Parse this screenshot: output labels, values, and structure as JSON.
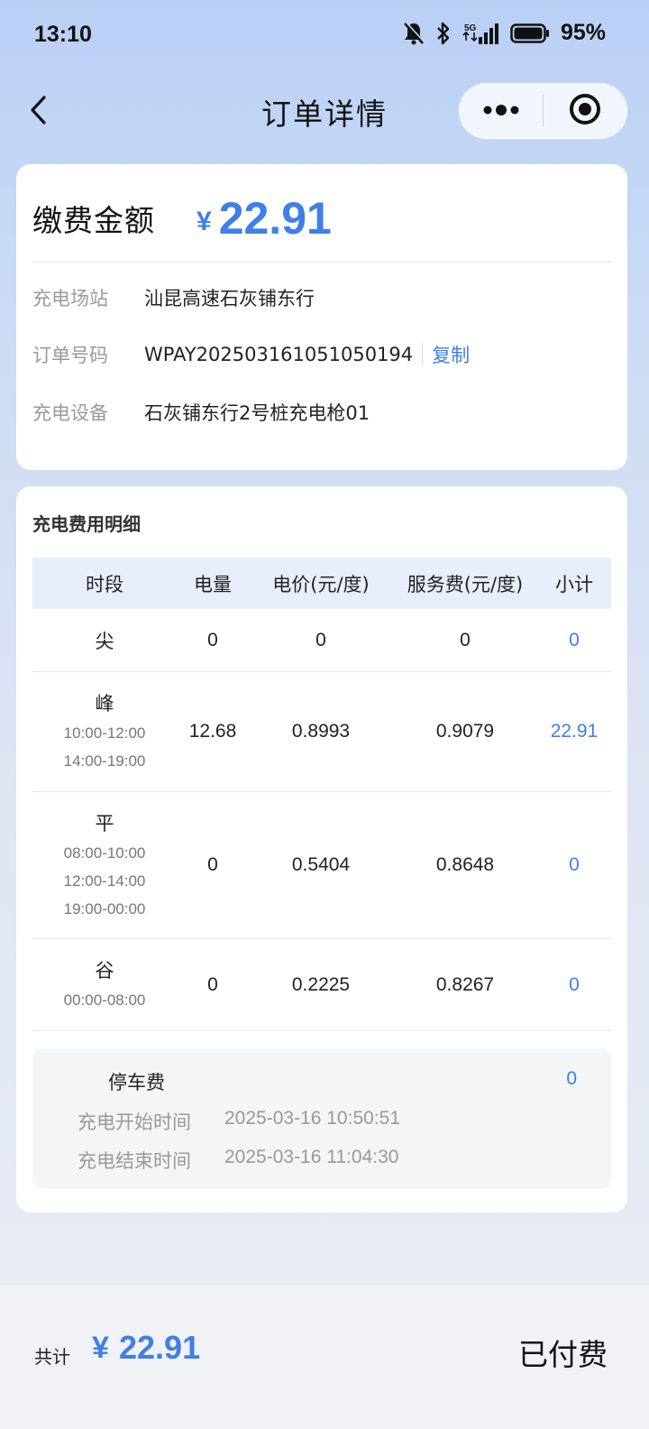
{
  "status_bar": {
    "time": "13:10",
    "icons": [
      "mute-bell-icon",
      "bluetooth-icon",
      "signal-5g-icon",
      "battery-icon"
    ],
    "battery": "95%"
  },
  "nav": {
    "title": "订单详情",
    "back_icon": "chevron-left-icon",
    "more_icon": "more-dots-icon",
    "close_icon": "target-close-icon"
  },
  "summary": {
    "amount_label": "缴费金额",
    "currency": "¥",
    "amount": "22.91",
    "rows": [
      {
        "label": "充电场站",
        "value": "汕昆高速石灰铺东行"
      },
      {
        "label": "订单号码",
        "value": "WPAY20250316105105019​4",
        "action": "复制"
      },
      {
        "label": "充电设备",
        "value": "石灰铺东行2号桩充电枪01"
      }
    ]
  },
  "detail": {
    "title": "充电费用明细",
    "headers": [
      "时段",
      "电量",
      "电价(元/度)",
      "服务费(元/度)",
      "小计"
    ],
    "rows": [
      {
        "period": "尖",
        "times": [],
        "energy": "0",
        "price": "0",
        "service_fee": "0",
        "subtotal": "0"
      },
      {
        "period": "峰",
        "times": [
          "10:00-12:00",
          "14:00-19:00"
        ],
        "energy": "12.68",
        "price": "0.8993",
        "service_fee": "0.9079",
        "subtotal": "22.91"
      },
      {
        "period": "平",
        "times": [
          "08:00-10:00",
          "12:00-14:00",
          "19:00-00:00"
        ],
        "energy": "0",
        "price": "0.5404",
        "service_fee": "0.8648",
        "subtotal": "0"
      },
      {
        "period": "谷",
        "times": [
          "00:00-08:00"
        ],
        "energy": "0",
        "price": "0.2225",
        "service_fee": "0.8267",
        "subtotal": "0"
      }
    ],
    "parking": {
      "label": "停车费",
      "value": "0",
      "start_label": "充电开始时间",
      "start_value": "2025-03-16 10:50:51",
      "end_label": "充电结束时间",
      "end_value": "2025-03-16 11:04:30"
    }
  },
  "footer": {
    "total_label": "共计",
    "currency": "¥",
    "total": "22.91",
    "status": "已付费"
  },
  "colors": {
    "accent": "#3f7fe8",
    "header_bg": "#e8eefb"
  }
}
